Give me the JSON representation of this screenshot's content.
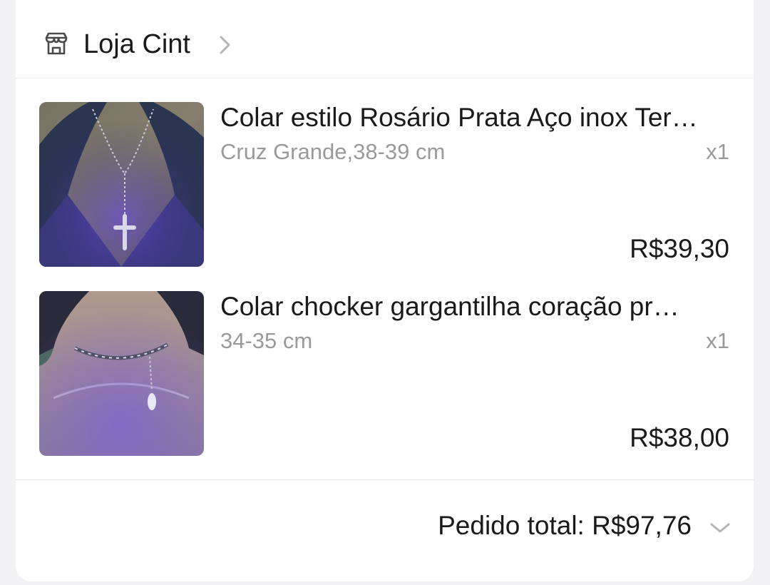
{
  "store": {
    "name": "Loja Cint",
    "icon": "store-icon",
    "chevron_icon": "chevron-right-icon"
  },
  "items": [
    {
      "title": "Colar estilo Rosário Prata Aço inox Ter…",
      "variant": "Cruz Grande,38-39 cm",
      "quantity": "x1",
      "price": "R$39,30",
      "image": "rosary-necklace-photo"
    },
    {
      "title": "Colar chocker gargantilha coração pr…",
      "variant": "34-35 cm",
      "quantity": "x1",
      "price": "R$38,00",
      "image": "choker-necklace-photo"
    }
  ],
  "order": {
    "total_label": "Pedido total: ",
    "total_value": "R$97,76",
    "expand_icon": "chevron-down-icon"
  },
  "colors": {
    "background": "#f2f2f4",
    "card": "#ffffff",
    "text": "#1a1a1a",
    "muted": "#9a9a9a"
  }
}
